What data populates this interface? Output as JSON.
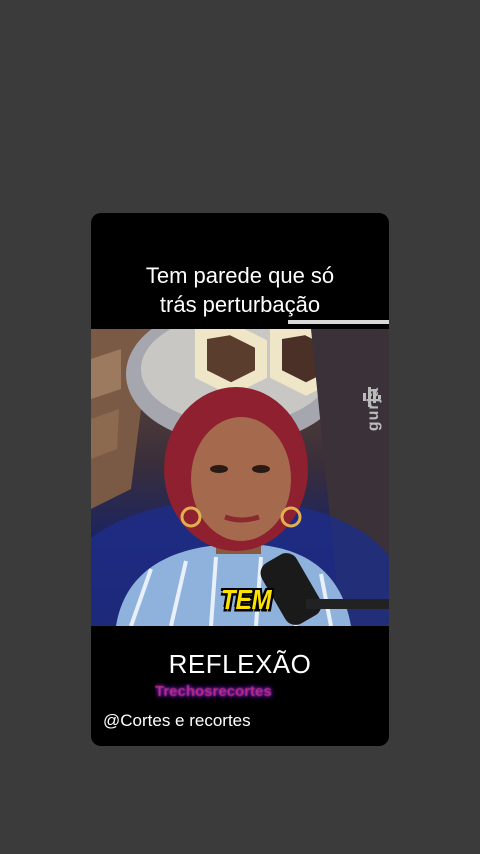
{
  "post": {
    "caption_lines": [
      "Tem parede que só",
      "trás perturbação"
    ],
    "video": {
      "watermark": "gurja",
      "subtitle_word": "TEM"
    },
    "title": "REFLEXÃO",
    "scribbled_text": "Trechosrecortes",
    "handle": "@Cortes e recortes"
  },
  "colors": {
    "background": "#3b3b3b",
    "card": "#000000",
    "subtitle": "#ffe100",
    "scribble": "#c0307a"
  }
}
